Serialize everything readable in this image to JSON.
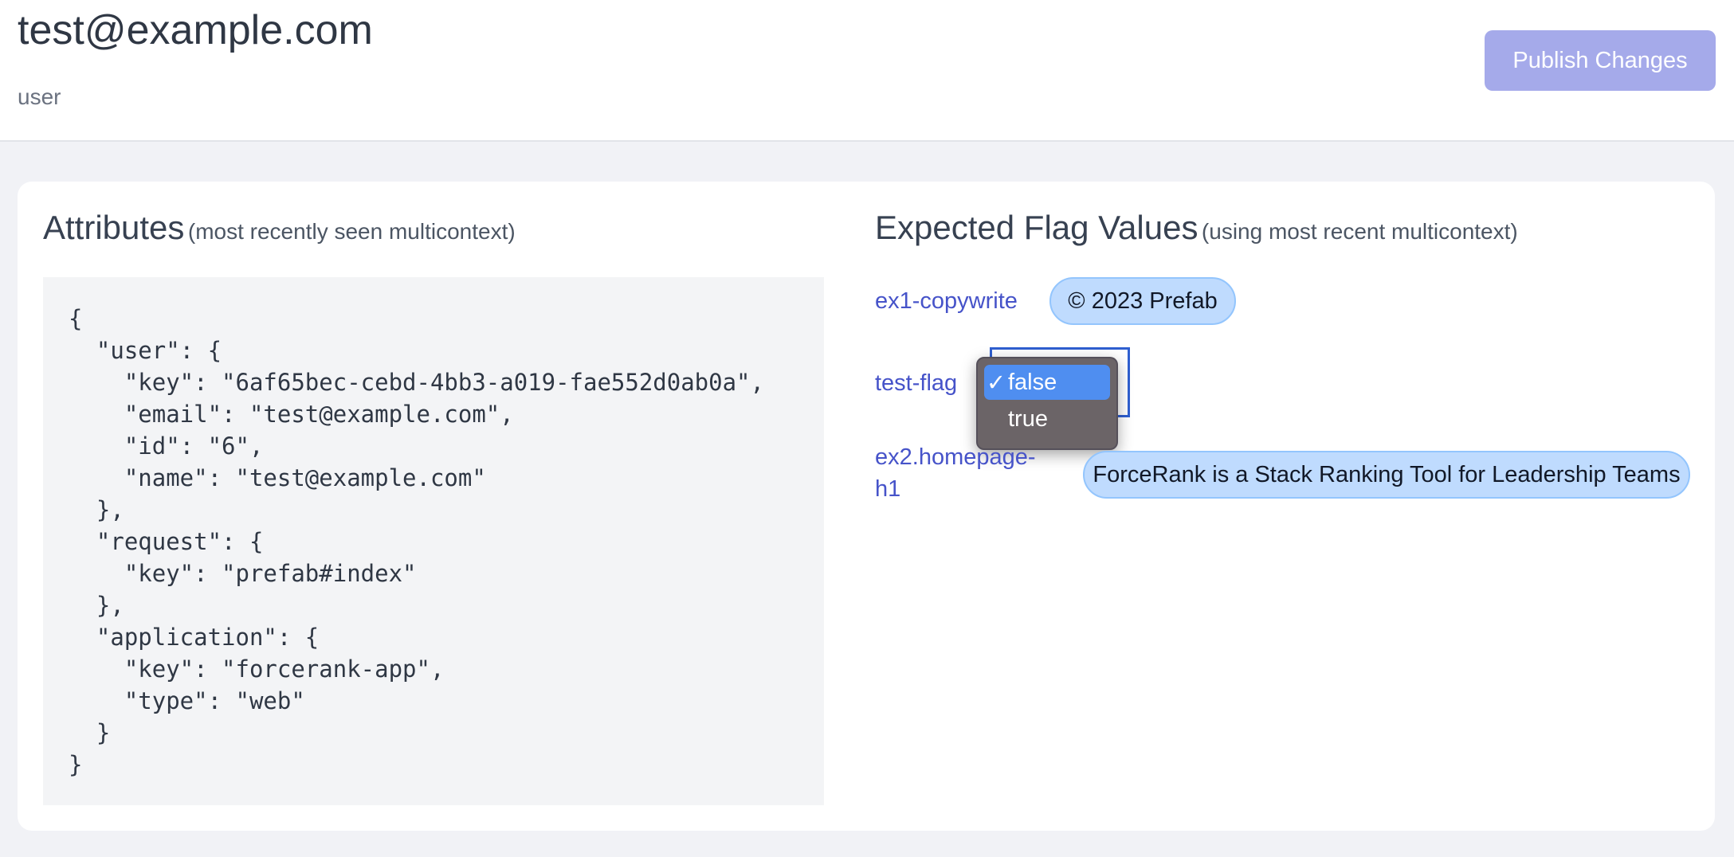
{
  "header": {
    "title": "test@example.com",
    "subtitle": "user",
    "publish_label": "Publish Changes"
  },
  "attributes": {
    "heading": "Attributes",
    "heading_note": "(most recently seen multicontext)",
    "code_lines": [
      "{",
      "  \"user\": {",
      "    \"key\": \"6af65bec-cebd-4bb3-a019-fae552d0ab0a\",",
      "    \"email\": \"test@example.com\",",
      "    \"id\": \"6\",",
      "    \"name\": \"test@example.com\"",
      "  },",
      "  \"request\": {",
      "    \"key\": \"prefab#index\"",
      "  },",
      "  \"application\": {",
      "    \"key\": \"forcerank-app\",",
      "    \"type\": \"web\"",
      "  }",
      "}"
    ]
  },
  "flags": {
    "heading": "Expected Flag Values",
    "heading_note": "(using most recent multicontext)",
    "items": [
      {
        "key": "ex1-copywrite",
        "value": "© 2023 Prefab"
      },
      {
        "key": "test-flag",
        "value": "false"
      },
      {
        "key_line1": "ex2.homepage-",
        "key_line2": "h1",
        "value": "ForceRank is a Stack Ranking Tool for Leadership Teams"
      }
    ],
    "dropdown": {
      "options": [
        {
          "label": "false",
          "selected": true,
          "check": "✓"
        },
        {
          "label": "true",
          "selected": false
        }
      ]
    }
  },
  "colors": {
    "accent": "#a5aaea",
    "link": "#4653c9",
    "pill_bg": "#bfdbfe",
    "select_border": "#2f5fd0",
    "dropdown_bg": "#6b6467",
    "dropdown_highlight": "#4f8ef0"
  }
}
